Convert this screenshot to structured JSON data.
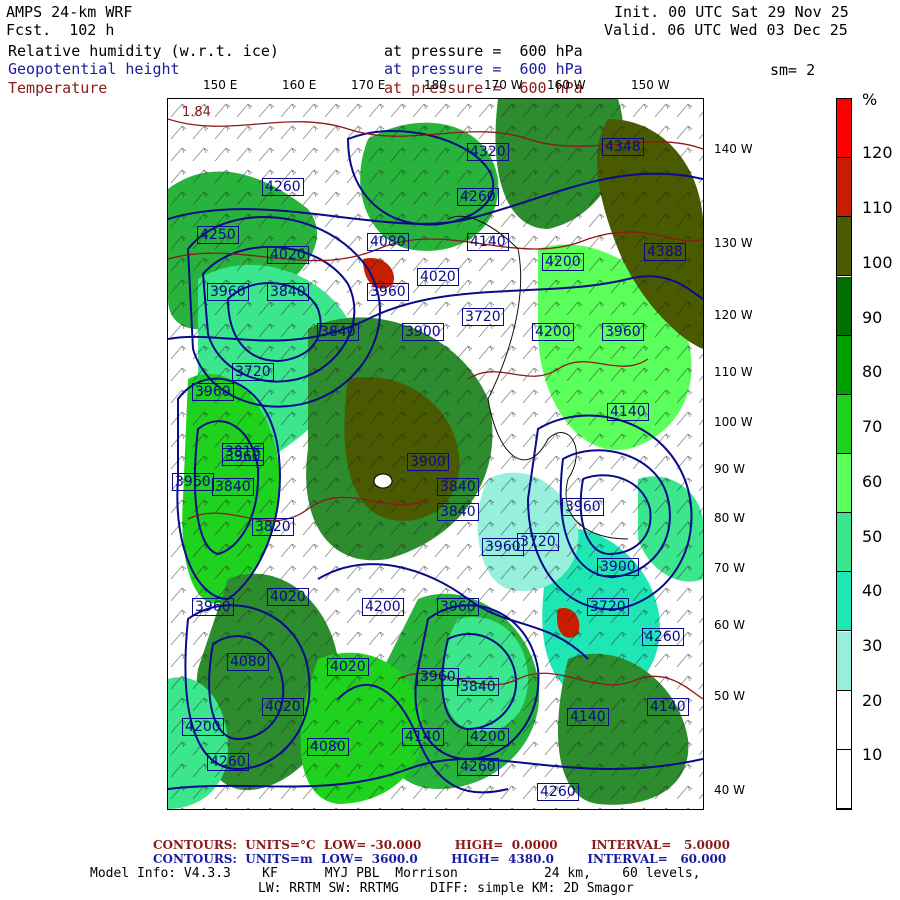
{
  "header": {
    "model": "AMPS 24-km WRF",
    "fcst": "Fcst.  102 h",
    "init": "Init. 00 UTC Sat 29 Nov 25",
    "valid": "Valid. 06 UTC Wed 03 Dec 25",
    "field1": "Relative humidity (w.r.t. ice)",
    "field2": "Geopotential height",
    "field3": "Temperature",
    "pressure1": "at pressure =  600 hPa",
    "pressure2": "at pressure =  600 hPa",
    "pressure3": "at pressure =  600 hPa",
    "smoothing": "sm= 2"
  },
  "lon_labels_top": [
    "150 E",
    "160 E",
    "170 E",
    "180",
    "170 W",
    "160 W",
    "150 W"
  ],
  "lon_labels_right": [
    "140 W",
    "130 W",
    "120 W",
    "110 W",
    "100 W",
    "90 W",
    "80 W",
    "70 W",
    "60 W",
    "50 W",
    "40 W"
  ],
  "corner_value": "1.84",
  "height_labels": [
    "4260",
    "4320",
    "4260",
    "4348",
    "4250",
    "4020",
    "4080",
    "4140",
    "4020",
    "4200",
    "4388",
    "3960",
    "3840",
    "3960",
    "3720",
    "3840",
    "3900",
    "4200",
    "3960",
    "3960",
    "3720",
    "4140",
    "3960",
    "3840",
    "3960",
    "3816",
    "3900",
    "3840",
    "3720",
    "3820",
    "3840",
    "3960",
    "3960",
    "3900",
    "3960",
    "4020",
    "4200",
    "3960",
    "3720",
    "4080",
    "4020",
    "3960",
    "3840",
    "4080",
    "4140",
    "4200",
    "4020",
    "4140",
    "4260",
    "4200",
    "4260",
    "4140",
    "4260",
    "4260"
  ],
  "colorbar": {
    "unit": "%",
    "labels": [
      "120",
      "110",
      "100",
      "90",
      "80",
      "70",
      "60",
      "50",
      "40",
      "30",
      "20",
      "10"
    ],
    "colors": [
      "#ff0000",
      "#c81e00",
      "#4a5a00",
      "#006e00",
      "#00a000",
      "#1ed21e",
      "#5aff5a",
      "#3ce68c",
      "#1ee6b4",
      "#96f0dc",
      "#ffffff",
      "#ffffff"
    ]
  },
  "footer": {
    "temp_contours": "CONTOURS:  UNITS=°C  LOW= -30.000        HIGH=  0.0000        INTERVAL=   5.0000",
    "height_contours": "CONTOURS:  UNITS=m  LOW=  3600.0        HIGH=  4380.0        INTERVAL=   60.000",
    "model_info": "Model Info: V4.3.3    KF      MYJ PBL  Morrison           24 km,    60 levels,",
    "model_info2": "LW: RRTM SW: RRTMG    DIFF: simple KM: 2D Smagor"
  },
  "colors": {
    "height_contour": "#0a0a8c",
    "temp_contour": "#8b1a1a",
    "header_blue": "#1a1aa0",
    "header_red": "#8b1a1a"
  }
}
